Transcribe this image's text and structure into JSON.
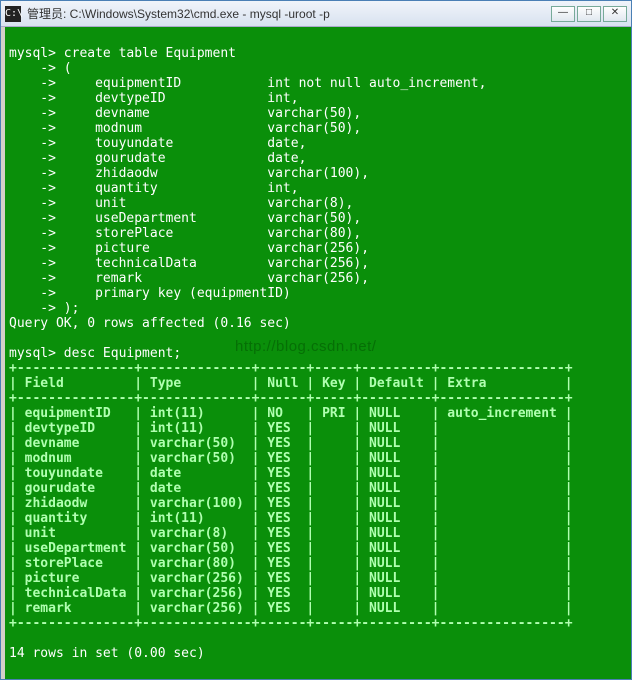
{
  "titlebar": {
    "icon_label": "C:\\",
    "title_text": "管理员: C:\\Windows\\System32\\cmd.exe - mysql  -uroot -p"
  },
  "prompt1": "mysql> create table Equipment",
  "create_table_lines": [
    "    -> (",
    "    ->     equipmentID           int not null auto_increment,",
    "    ->     devtypeID             int,",
    "    ->     devname               varchar(50),",
    "    ->     modnum                varchar(50),",
    "    ->     touyundate            date,",
    "    ->     gourudate             date,",
    "    ->     zhidaodw              varchar(100),",
    "    ->     quantity              int,",
    "    ->     unit                  varchar(8),",
    "    ->     useDepartment         varchar(50),",
    "    ->     storePlace            varchar(80),",
    "    ->     picture               varchar(256),",
    "    ->     technicalData         varchar(256),",
    "    ->     remark                varchar(256),",
    "    ->     primary key (equipmentID)",
    "    -> );"
  ],
  "query_ok": "Query OK, 0 rows affected (0.16 sec)",
  "prompt2": "mysql> desc Equipment;",
  "table_border_top": "+---------------+--------------+------+-----+---------+----------------+",
  "table_header": "| Field         | Type         | Null | Key | Default | Extra          |",
  "table_border_mid": "+---------------+--------------+------+-----+---------+----------------+",
  "table_rows": [
    "| equipmentID   | int(11)      | NO   | PRI | NULL    | auto_increment |",
    "| devtypeID     | int(11)      | YES  |     | NULL    |                |",
    "| devname       | varchar(50)  | YES  |     | NULL    |                |",
    "| modnum        | varchar(50)  | YES  |     | NULL    |                |",
    "| touyundate    | date         | YES  |     | NULL    |                |",
    "| gourudate     | date         | YES  |     | NULL    |                |",
    "| zhidaodw      | varchar(100) | YES  |     | NULL    |                |",
    "| quantity      | int(11)      | YES  |     | NULL    |                |",
    "| unit          | varchar(8)   | YES  |     | NULL    |                |",
    "| useDepartment | varchar(50)  | YES  |     | NULL    |                |",
    "| storePlace    | varchar(80)  | YES  |     | NULL    |                |",
    "| picture       | varchar(256) | YES  |     | NULL    |                |",
    "| technicalData | varchar(256) | YES  |     | NULL    |                |",
    "| remark        | varchar(256) | YES  |     | NULL    |                |"
  ],
  "table_border_bot": "+---------------+--------------+------+-----+---------+----------------+",
  "rows_in_set": "14 rows in set (0.00 sec)",
  "watermark": "http://blog.csdn.net/"
}
